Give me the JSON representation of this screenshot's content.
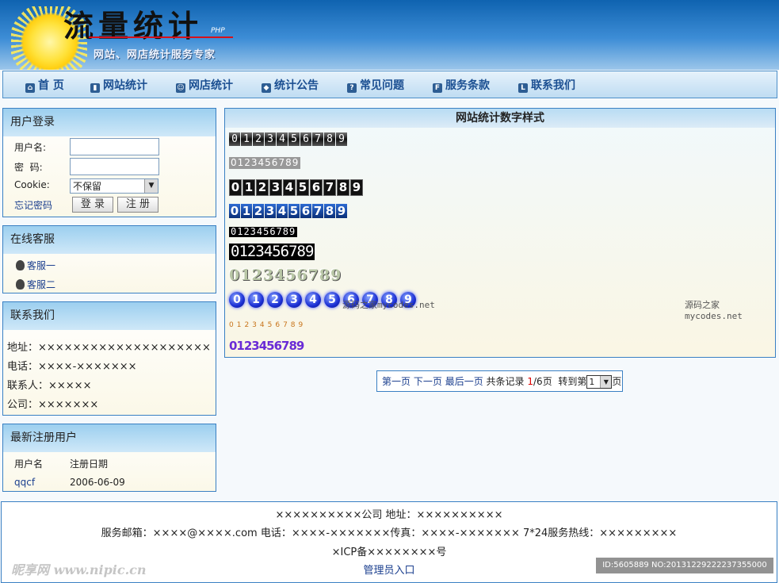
{
  "logo": {
    "text": "流量统计",
    "php": "PHP",
    "slogan": "网站、网店统计服务专家"
  },
  "nav": [
    {
      "label": "首 页",
      "icon": "home-icon"
    },
    {
      "label": "网站统计",
      "icon": "stats-icon"
    },
    {
      "label": "网店统计",
      "icon": "shop-icon"
    },
    {
      "label": "统计公告",
      "icon": "notice-icon"
    },
    {
      "label": "常见问题",
      "icon": "faq-icon"
    },
    {
      "label": "服务条款",
      "icon": "terms-icon"
    },
    {
      "label": "联系我们",
      "icon": "contact-icon"
    }
  ],
  "login": {
    "title": "用户登录",
    "username_label": "用户名:",
    "password_label": "密  码:",
    "cookie_label": "Cookie:",
    "cookie_value": "不保留",
    "forgot": "忘记密码",
    "login_btn": "登 录",
    "register_btn": "注 册"
  },
  "service": {
    "title": "在线客服",
    "items": [
      "客服一",
      "客服二"
    ]
  },
  "contact": {
    "title": "联系我们",
    "address": "地址：××××××××××××××××××××",
    "phone": "电话：××××-×××××××",
    "person": "联系人：×××××",
    "company": "公司：×××××××"
  },
  "newusers": {
    "title": "最新注册用户",
    "headers": [
      "用户名",
      "注册日期"
    ],
    "rows": [
      [
        "qqcf",
        "2006-06-09"
      ]
    ]
  },
  "main": {
    "title": "网站统计数字样式",
    "digits": "0123456789",
    "watermark": "源码之家mycodes.net"
  },
  "pager": {
    "first": "第一页",
    "next": "下一页",
    "last": "最后一页",
    "total_prefix": "共条记录",
    "current": "1",
    "total": "/6页",
    "goto": "转到第",
    "page_value": "1",
    "page_suffix": "页"
  },
  "footer": {
    "line1": "××××××××××公司 地址：××××××××××",
    "line2": "服务邮箱：××××@××××.com 电话：××××-×××××××传真：××××-××××××× 7*24服务热线：×××××××××",
    "line3": "×ICP备××××××××号",
    "admin": "管理员入口"
  },
  "nipic": {
    "logo": "昵享网 www.nipic.cn",
    "id": "ID:5605889 NO:20131229222237355000"
  }
}
